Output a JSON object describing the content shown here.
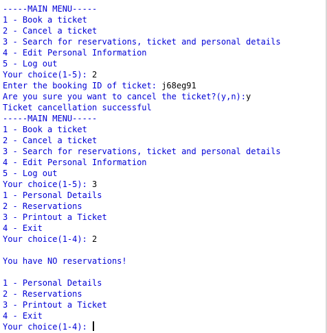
{
  "console": {
    "lines": [
      [
        {
          "t": "-----MAIN MENU-----",
          "c": "sys"
        }
      ],
      [
        {
          "t": "1 - Book a ticket",
          "c": "sys"
        }
      ],
      [
        {
          "t": "2 - Cancel a ticket",
          "c": "sys"
        }
      ],
      [
        {
          "t": "3 - Search for reservations, ticket and personal details",
          "c": "sys"
        }
      ],
      [
        {
          "t": "4 - Edit Personal Information",
          "c": "sys"
        }
      ],
      [
        {
          "t": "5 - Log out",
          "c": "sys"
        }
      ],
      [
        {
          "t": "Your choice(1-5): ",
          "c": "sys"
        },
        {
          "t": "2",
          "c": "usr"
        }
      ],
      [
        {
          "t": "Enter the booking ID of ticket: ",
          "c": "sys"
        },
        {
          "t": "j68eg91",
          "c": "usr"
        }
      ],
      [
        {
          "t": "Are you sure you want to cancel the ticket?(y,n):",
          "c": "sys"
        },
        {
          "t": "y",
          "c": "usr"
        }
      ],
      [
        {
          "t": "Ticket cancellation successful",
          "c": "sys"
        }
      ],
      [
        {
          "t": "-----MAIN MENU-----",
          "c": "sys"
        }
      ],
      [
        {
          "t": "1 - Book a ticket",
          "c": "sys"
        }
      ],
      [
        {
          "t": "2 - Cancel a ticket",
          "c": "sys"
        }
      ],
      [
        {
          "t": "3 - Search for reservations, ticket and personal details",
          "c": "sys"
        }
      ],
      [
        {
          "t": "4 - Edit Personal Information",
          "c": "sys"
        }
      ],
      [
        {
          "t": "5 - Log out",
          "c": "sys"
        }
      ],
      [
        {
          "t": "Your choice(1-5): ",
          "c": "sys"
        },
        {
          "t": "3",
          "c": "usr"
        }
      ],
      [
        {
          "t": "1 - Personal Details",
          "c": "sys"
        }
      ],
      [
        {
          "t": "2 - Reservations",
          "c": "sys"
        }
      ],
      [
        {
          "t": "3 - Printout a Ticket",
          "c": "sys"
        }
      ],
      [
        {
          "t": "4 - Exit",
          "c": "sys"
        }
      ],
      [
        {
          "t": "Your choice(1-4): ",
          "c": "sys"
        },
        {
          "t": "2",
          "c": "usr"
        }
      ],
      [],
      [
        {
          "t": "You have NO reservations!",
          "c": "sys"
        }
      ],
      [],
      [
        {
          "t": "1 - Personal Details",
          "c": "sys"
        }
      ],
      [
        {
          "t": "2 - Reservations",
          "c": "sys"
        }
      ],
      [
        {
          "t": "3 - Printout a Ticket",
          "c": "sys"
        }
      ],
      [
        {
          "t": "4 - Exit",
          "c": "sys"
        }
      ],
      [
        {
          "t": "Your choice(1-4): ",
          "c": "sys"
        }
      ]
    ],
    "input_line_index": 29,
    "colors": {
      "system_text": "#0000d6",
      "user_text": "#000000",
      "background": "#ffffff"
    }
  }
}
